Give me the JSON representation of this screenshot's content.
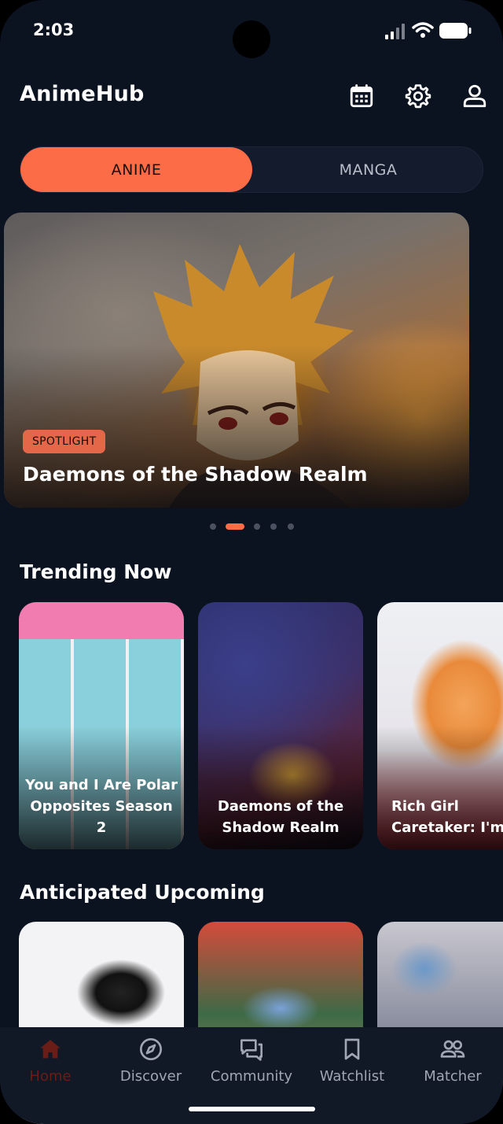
{
  "status_bar": {
    "time": "2:03"
  },
  "header": {
    "title": "AnimeHub",
    "icons": [
      "calendar-icon",
      "settings-icon",
      "user-icon"
    ]
  },
  "segment": {
    "options": [
      "ANIME",
      "MANGA"
    ],
    "selected": "ANIME"
  },
  "spotlight": {
    "badge": "SPOTLIGHT",
    "title": "Daemons of the Shadow Realm",
    "pager": {
      "count": 5,
      "active_index": 1
    }
  },
  "trending": {
    "title": "Trending Now",
    "items": [
      {
        "title": "You and I Are Polar\nOpposites Season 2"
      },
      {
        "title": "Daemons of the\nShadow Realm"
      },
      {
        "title": "Rich Girl\nCaretaker: I'm S"
      }
    ]
  },
  "upcoming": {
    "title": "Anticipated Upcoming"
  },
  "bottom_nav": {
    "items": [
      {
        "label": "Home",
        "icon": "home-icon",
        "active": true
      },
      {
        "label": "Discover",
        "icon": "compass-icon",
        "active": false
      },
      {
        "label": "Community",
        "icon": "chat-icon",
        "active": false
      },
      {
        "label": "Watchlist",
        "icon": "bookmark-icon",
        "active": false
      },
      {
        "label": "Matcher",
        "icon": "people-icon",
        "active": false
      }
    ]
  },
  "colors": {
    "accent": "#fb6c47",
    "background": "#0b1220",
    "nav_background": "#111826",
    "active_nav": "#6a1d16"
  }
}
